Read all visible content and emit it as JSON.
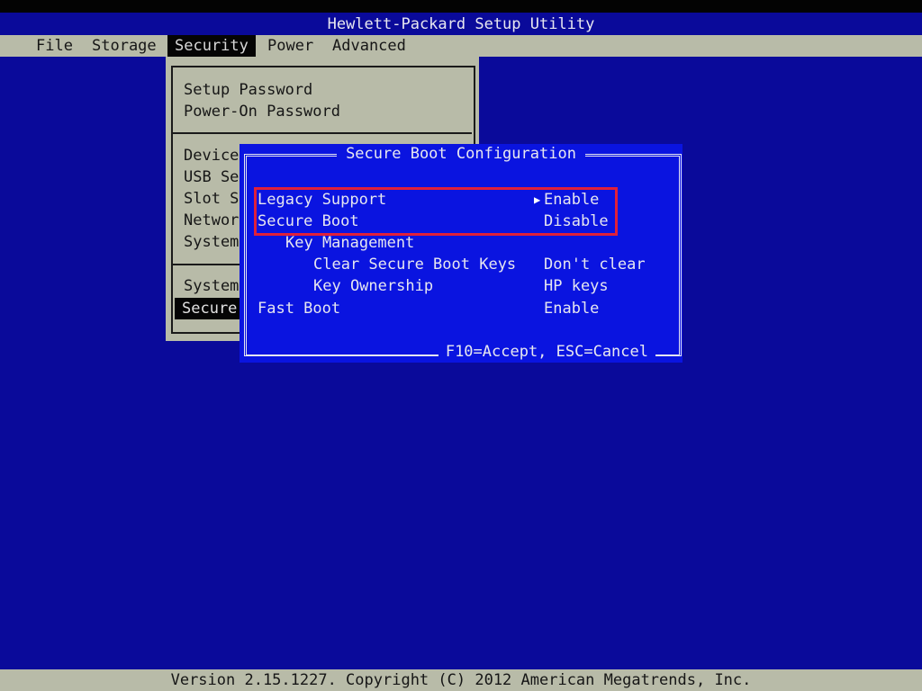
{
  "app": {
    "title": "Hewlett-Packard Setup Utility"
  },
  "menubar": {
    "items": [
      {
        "label": "File",
        "active": false
      },
      {
        "label": "Storage",
        "active": false
      },
      {
        "label": "Security",
        "active": true
      },
      {
        "label": "Power",
        "active": false
      },
      {
        "label": "Advanced",
        "active": false
      }
    ]
  },
  "security_menu": {
    "groups": [
      [
        "Setup Password",
        "Power-On Password"
      ],
      [
        "Device",
        "USB Se",
        "Slot S",
        "Networ",
        "System"
      ],
      [
        "System",
        "Secure"
      ]
    ],
    "selected": "Secure"
  },
  "dialog": {
    "title": "Secure Boot Configuration",
    "footer": "F10=Accept, ESC=Cancel",
    "rows": [
      {
        "label": "Legacy Support",
        "value": "Enable",
        "indent": 0,
        "focused": true
      },
      {
        "label": "Secure Boot",
        "value": "Disable",
        "indent": 0,
        "focused": false
      },
      {
        "label": "Key Management",
        "value": "",
        "indent": 1,
        "focused": false
      },
      {
        "label": "Clear Secure Boot Keys",
        "value": "Don't clear",
        "indent": 2,
        "focused": false
      },
      {
        "label": "Key Ownership",
        "value": "HP keys",
        "indent": 2,
        "focused": false
      },
      {
        "label": "Fast Boot",
        "value": "Enable",
        "indent": 0,
        "focused": false
      }
    ],
    "pointer_glyph": "▶",
    "highlight_color": "#e0203a"
  },
  "status": {
    "text": "Version 2.15.1227. Copyright (C) 2012 American Megatrends, Inc."
  },
  "colors": {
    "background": "#0a0a9a",
    "dialog": "#0a14e0",
    "menu": "#b8bba8"
  }
}
